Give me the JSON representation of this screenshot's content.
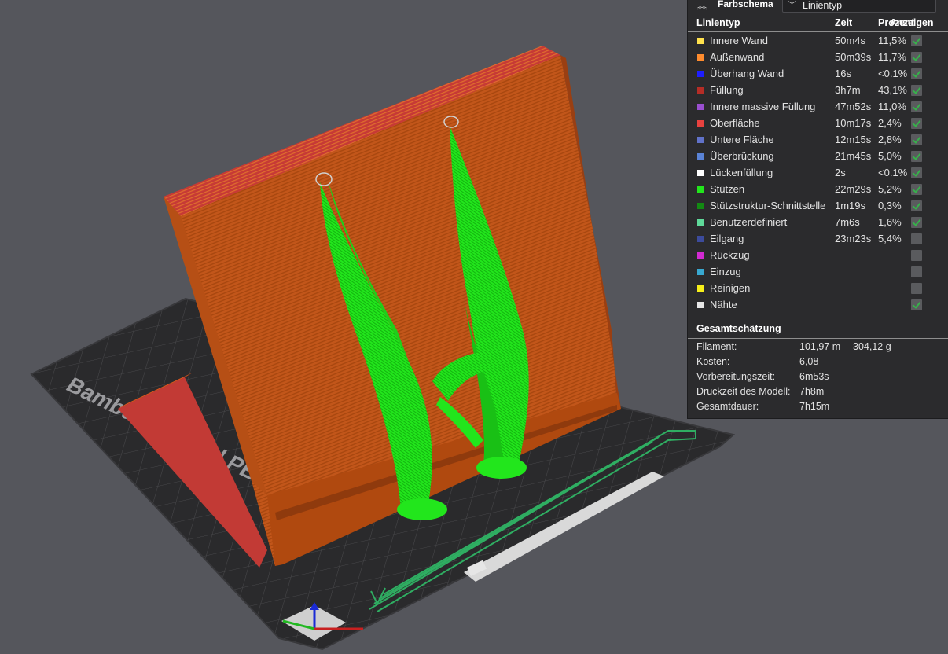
{
  "panel": {
    "header_label": "Farbschema",
    "scheme_value": "Linientyp",
    "col_type": "Linientyp",
    "col_time": "Zeit",
    "col_percent": "Prozent",
    "col_show": "Anzeigen",
    "rows": [
      {
        "name": "Innere Wand",
        "time": "50m4s",
        "pct": "11,5%",
        "color": "#ffe14d",
        "checked": true
      },
      {
        "name": "Außenwand",
        "time": "50m39s",
        "pct": "11,7%",
        "color": "#ff8c2e",
        "checked": true
      },
      {
        "name": "Überhang Wand",
        "time": "16s",
        "pct": "<0.1%",
        "color": "#1e1eff",
        "checked": true
      },
      {
        "name": "Füllung",
        "time": "3h7m",
        "pct": "43,1%",
        "color": "#b52d26",
        "checked": true
      },
      {
        "name": "Innere massive Füllung",
        "time": "47m52s",
        "pct": "11,0%",
        "color": "#9a4fd0",
        "checked": true
      },
      {
        "name": "Oberfläche",
        "time": "10m17s",
        "pct": "2,4%",
        "color": "#e8423f",
        "checked": true
      },
      {
        "name": "Untere Fläche",
        "time": "12m15s",
        "pct": "2,8%",
        "color": "#6172c9",
        "checked": true
      },
      {
        "name": "Überbrückung",
        "time": "21m45s",
        "pct": "5,0%",
        "color": "#5a83d6",
        "checked": true
      },
      {
        "name": "Lückenfüllung",
        "time": "2s",
        "pct": "<0.1%",
        "color": "#ffffff",
        "checked": true
      },
      {
        "name": "Stützen",
        "time": "22m29s",
        "pct": "5,2%",
        "color": "#22e61c",
        "checked": true
      },
      {
        "name": "Stützstruktur-Schnittstelle",
        "time": "1m19s",
        "pct": "0,3%",
        "color": "#138a13",
        "checked": true
      },
      {
        "name": "Benutzerdefiniert",
        "time": "7m6s",
        "pct": "1,6%",
        "color": "#5fd99a",
        "checked": true
      },
      {
        "name": "Eilgang",
        "time": "23m23s",
        "pct": "5,4%",
        "color": "#3c4b9c",
        "checked": false
      },
      {
        "name": "Rückzug",
        "time": "",
        "pct": "",
        "color": "#d22ad2",
        "checked": false
      },
      {
        "name": "Einzug",
        "time": "",
        "pct": "",
        "color": "#38a8d0",
        "checked": false
      },
      {
        "name": "Reinigen",
        "time": "",
        "pct": "",
        "color": "#f6ef1a",
        "checked": false
      },
      {
        "name": "Nähte",
        "time": "",
        "pct": "",
        "color": "#e6e6e6",
        "checked": true
      }
    ],
    "summary_title": "Gesamtschätzung",
    "summary": [
      {
        "key": "Filament:",
        "v1": "101,97 m",
        "v2": "304,12 g"
      },
      {
        "key": "Kosten:",
        "v1": "6,08",
        "v2": ""
      },
      {
        "key": "Vorbereitungszeit:",
        "v1": "6m53s",
        "v2": ""
      },
      {
        "key": "Druckzeit des Modell:",
        "v1": "7h8m",
        "v2": ""
      },
      {
        "key": "Gesamtdauer:",
        "v1": "7h15m",
        "v2": ""
      }
    ]
  },
  "scene": {
    "plate_label": "Bambu Textured PEI Plate"
  }
}
